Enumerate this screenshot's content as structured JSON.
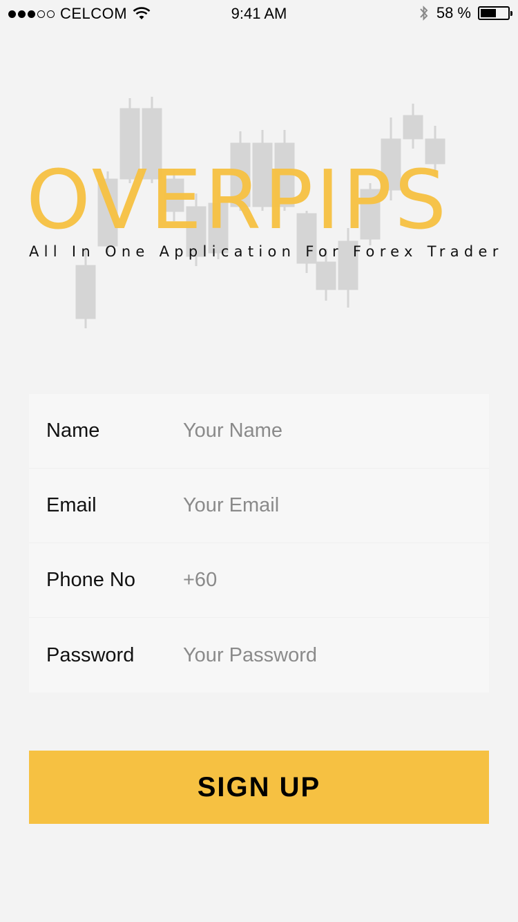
{
  "status_bar": {
    "carrier": "CELCOM",
    "time": "9:41 AM",
    "battery_percent": "58 %",
    "signal_bars_filled": 3,
    "signal_bars_total": 5,
    "battery_level": 0.58
  },
  "logo": {
    "title": "OVERPIPS",
    "tagline": "All In One Application For Forex Trader",
    "brand_color": "#f7c142"
  },
  "form": {
    "fields": [
      {
        "label": "Name",
        "placeholder": "Your Name",
        "value": ""
      },
      {
        "label": "Email",
        "placeholder": "Your Email",
        "value": ""
      },
      {
        "label": "Phone No",
        "placeholder": "+60",
        "value": ""
      },
      {
        "label": "Password",
        "placeholder": "Your Password",
        "value": ""
      }
    ]
  },
  "signup": {
    "label": "SIGN UP",
    "color": "#f6c142"
  }
}
